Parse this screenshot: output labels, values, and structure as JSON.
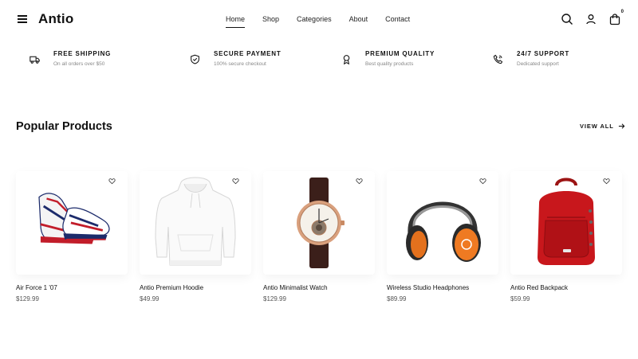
{
  "brand": "Antio",
  "nav": [
    "Home",
    "Shop",
    "Categories",
    "About",
    "Contact"
  ],
  "nav_active": "Home",
  "cart_count": "0",
  "features": [
    {
      "title": "FREE SHIPPING",
      "subtitle": "On all orders over $50",
      "icon": "truck-icon"
    },
    {
      "title": "SECURE PAYMENT",
      "subtitle": "100% secure checkout",
      "icon": "shield-check-icon"
    },
    {
      "title": "PREMIUM QUALITY",
      "subtitle": "Best quality products",
      "icon": "award-icon"
    },
    {
      "title": "24/7 SUPPORT",
      "subtitle": "Dedicated support",
      "icon": "phone-icon"
    }
  ],
  "section": {
    "title": "Popular Products",
    "view_all": "VIEW ALL"
  },
  "products": [
    {
      "name": "Air Force 1 '07",
      "price": "$129.99",
      "image": "sneaker-image"
    },
    {
      "name": "Antio Premium Hoodie",
      "price": "$49.99",
      "image": "hoodie-image"
    },
    {
      "name": "Antio Minimalist Watch",
      "price": "$129.99",
      "image": "watch-image"
    },
    {
      "name": "Wireless Studio Headphones",
      "price": "$89.99",
      "image": "headphones-image"
    },
    {
      "name": "Antio Red Backpack",
      "price": "$59.99",
      "image": "backpack-image"
    }
  ],
  "colors": {
    "text": "#111111",
    "muted": "#888888",
    "background": "#ffffff"
  }
}
